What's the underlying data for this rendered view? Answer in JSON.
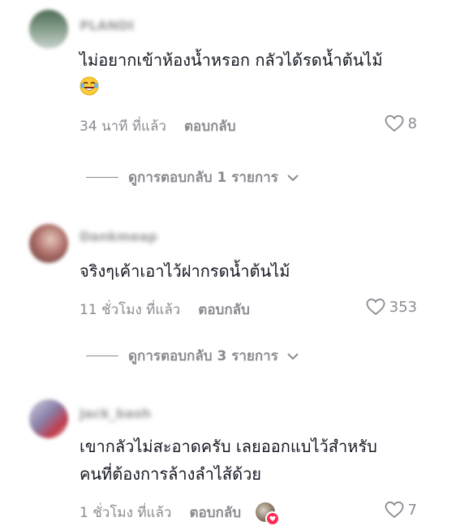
{
  "comments": [
    {
      "username": "PLANDI",
      "text_line1": "ไม่อยากเข้าห้องน้ำหรอก กลัวได้รดน้ำต้นไม้",
      "emoji": "laughing-with-tears-emoji",
      "time": "34 นาที ที่แล้ว",
      "reply_label": "ตอบกลับ",
      "likes": "8",
      "view_replies": "ดูการตอบกลับ 1 รายการ"
    },
    {
      "username": "Dankmeap",
      "text_line1": "จริงๆเค้าเอาไว้ฝากรดน้ำต้นไม้",
      "time": "11 ชั่วโมง ที่แล้ว",
      "reply_label": "ตอบกลับ",
      "likes": "353",
      "view_replies": "ดูการตอบกลับ 3 รายการ"
    },
    {
      "username": "Jack_bash",
      "text_line1": "เขากลัวไม่สะอาดครับ เลยออกแบไว้สำหรับ",
      "text_line2": "คนที่ต้องการล้างลำไส้ด้วย",
      "time": "1 ชั่วโมง ที่แล้ว",
      "reply_label": "ตอบกลับ",
      "likes": "7",
      "creator_liked": true
    }
  ],
  "colors": {
    "text": "#161823",
    "muted": "#8a8b91",
    "heart_badge": "#fe2c55"
  },
  "icons": {
    "like": "heart-outline-icon",
    "expand": "chevron-down-icon",
    "creator_like": "creator-liked-badge-icon"
  }
}
